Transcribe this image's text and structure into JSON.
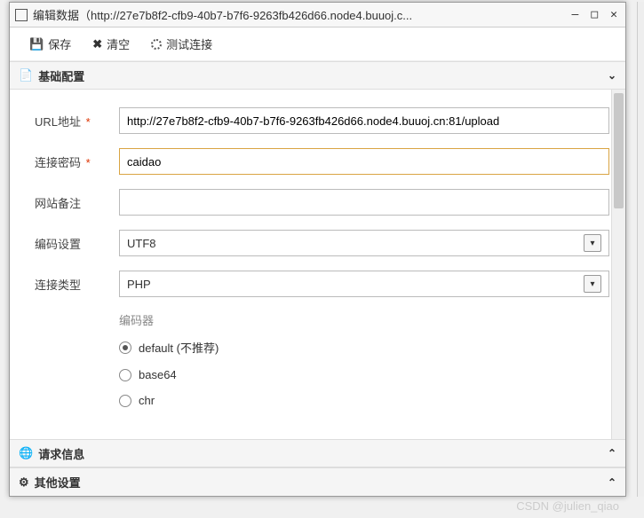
{
  "window": {
    "title": "编辑数据（http://27e7b8f2-cfb9-40b7-b7f6-9263fb426d66.node4.buuoj.c..."
  },
  "toolbar": {
    "save_label": "保存",
    "clear_label": "清空",
    "test_label": "测试连接"
  },
  "sections": {
    "basic": "基础配置",
    "request": "请求信息",
    "other": "其他设置"
  },
  "form": {
    "url_label": "URL地址",
    "url_value": "http://27e7b8f2-cfb9-40b7-b7f6-9263fb426d66.node4.buuoj.cn:81/upload",
    "password_label": "连接密码",
    "password_value": "caidao",
    "remark_label": "网站备注",
    "remark_value": "",
    "encoding_label": "编码设置",
    "encoding_value": "UTF8",
    "type_label": "连接类型",
    "type_value": "PHP",
    "encoder_title": "编码器",
    "encoders": [
      {
        "label": "default (不推荐)",
        "checked": true
      },
      {
        "label": "base64",
        "checked": false
      },
      {
        "label": "chr",
        "checked": false
      }
    ]
  },
  "watermark": "CSDN @julien_qiao"
}
